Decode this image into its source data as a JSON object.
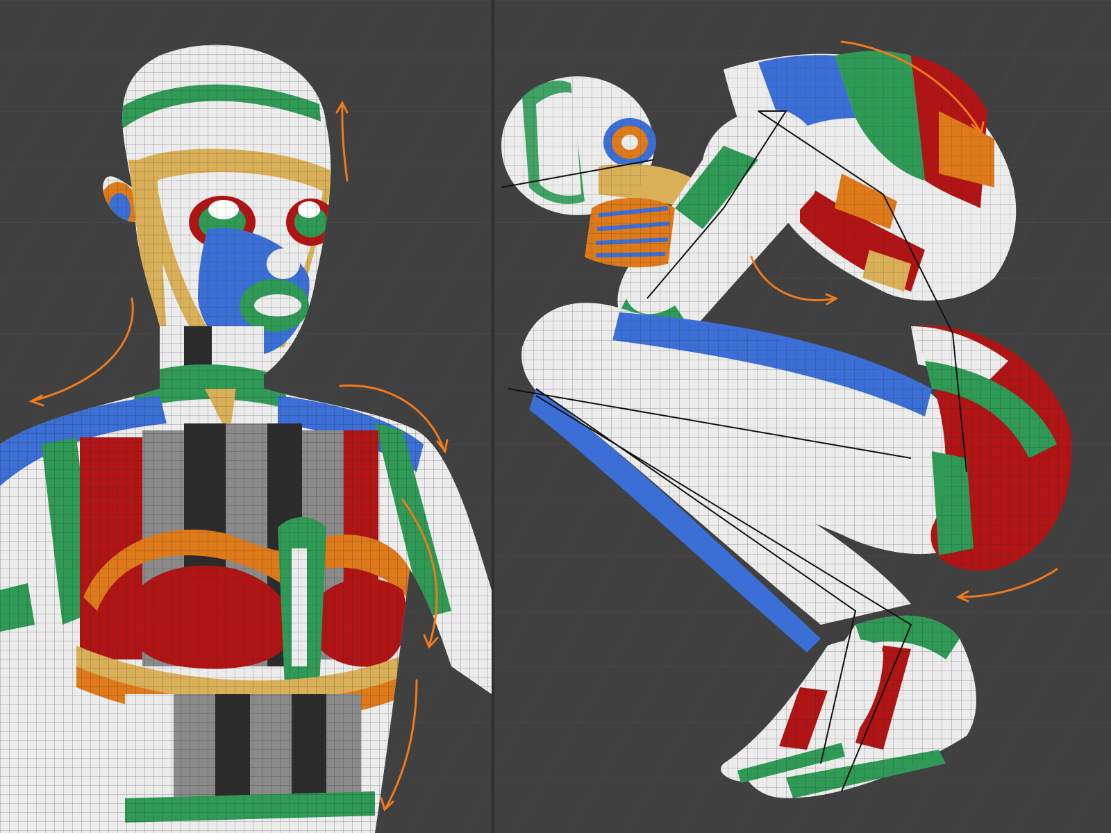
{
  "colors": {
    "background": "#404040",
    "grid": "#4a4a4a",
    "white": "#ececec",
    "wire": "#2a2a2a",
    "green": "#2e9a55",
    "blue": "#3b6fd6",
    "red": "#b01414",
    "orange": "#df7a1a",
    "yellow": "#d9b057",
    "gray": "#8a8a8a",
    "dark": "#2b2b2b",
    "arrow": "#f07a1e",
    "bone": "#111111"
  },
  "viewports": [
    {
      "name": "upper-body-viewport",
      "subject": "female-bust-uv-checker"
    },
    {
      "name": "crouching-pose-viewport",
      "subject": "crouching-figure-uv-checker"
    }
  ]
}
